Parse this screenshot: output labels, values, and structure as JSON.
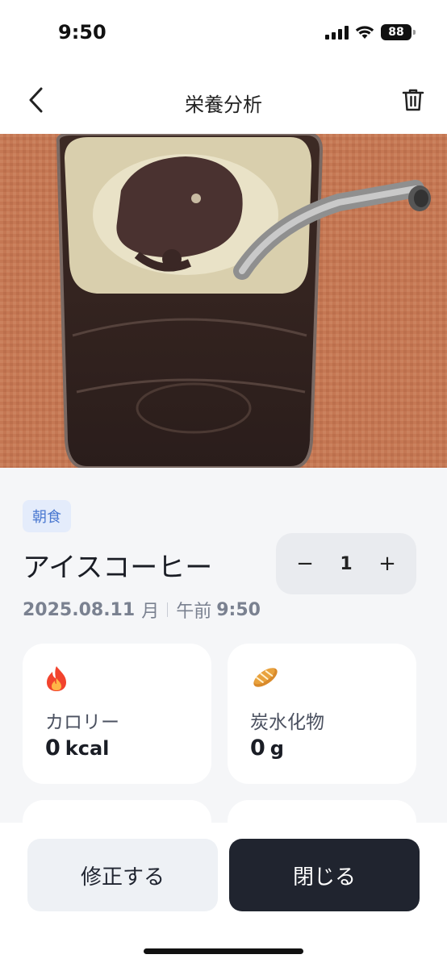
{
  "status_bar": {
    "time": "9:50",
    "battery": "88"
  },
  "nav": {
    "title": "栄養分析",
    "back_icon": "chevron-left-icon",
    "delete_icon": "trash-icon"
  },
  "photo": {
    "description_icon": "food-photo"
  },
  "meal": {
    "tag": "朝食",
    "name": "アイスコーヒー",
    "quantity": {
      "minus": "−",
      "value": "1",
      "plus": "+"
    },
    "date": "2025.08.11",
    "weekday": "月",
    "ampm": "午前",
    "time": "9:50"
  },
  "nutrients": [
    {
      "icon": "fire-icon",
      "label": "カロリー",
      "value": "0",
      "unit": "kcal"
    },
    {
      "icon": "bread-icon",
      "label": "炭水化物",
      "value": "0",
      "unit": "g"
    }
  ],
  "actions": {
    "edit": "修正する",
    "close": "閉じる"
  },
  "colors": {
    "accent": "#4a78d0",
    "primary_button": "#20242f",
    "tag_bg": "#e4ecfb"
  }
}
